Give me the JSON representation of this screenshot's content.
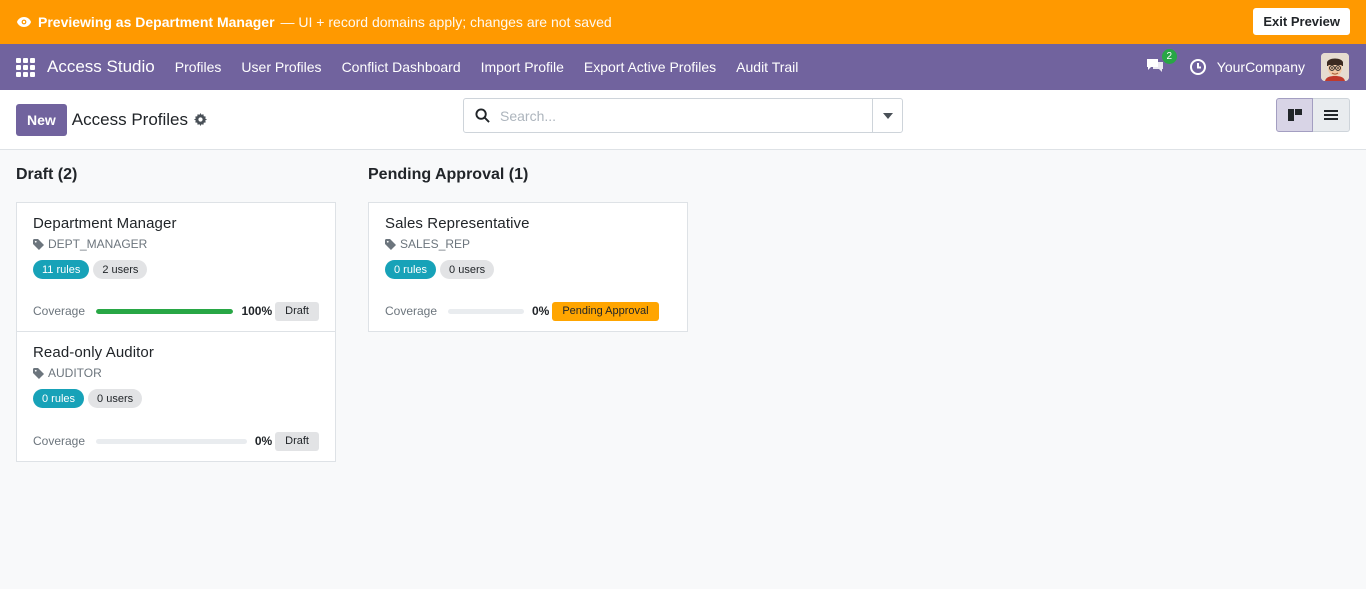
{
  "preview": {
    "strong": "Previewing as Department Manager",
    "rest": "— UI + record domains apply; changes are not saved",
    "exit_label": "Exit Preview"
  },
  "navbar": {
    "brand": "Access Studio",
    "menu": [
      "Profiles",
      "User Profiles",
      "Conflict Dashboard",
      "Import Profile",
      "Export Active Profiles",
      "Audit Trail"
    ],
    "chat_count": "2",
    "company": "YourCompany"
  },
  "control": {
    "new_label": "New",
    "title": "Access Profiles",
    "search_placeholder": "Search..."
  },
  "columns": [
    {
      "header": "Draft (2)",
      "cards": [
        {
          "title": "Department Manager",
          "code": "DEPT_MANAGER",
          "rules": "11 rules",
          "users": "2 users",
          "coverage_label": "Coverage",
          "coverage": 100,
          "coverage_text": "100%",
          "status": "Draft",
          "status_kind": "draft"
        },
        {
          "title": "Read-only Auditor",
          "code": "AUDITOR",
          "rules": "0 rules",
          "users": "0 users",
          "coverage_label": "Coverage",
          "coverage": 0,
          "coverage_text": "0%",
          "status": "Draft",
          "status_kind": "draft"
        }
      ]
    },
    {
      "header": "Pending Approval (1)",
      "cards": [
        {
          "title": "Sales Representative",
          "code": "SALES_REP",
          "rules": "0 rules",
          "users": "0 users",
          "coverage_label": "Coverage",
          "coverage": 0,
          "coverage_text": "0%",
          "status": "Pending Approval",
          "status_kind": "pending"
        }
      ]
    }
  ],
  "colors": {
    "preview_bar": "#ff9900",
    "navbar": "#71639e",
    "rules_pill": "#17a2b8",
    "coverage_fill": "#28a745",
    "pending": "#ffa500"
  }
}
